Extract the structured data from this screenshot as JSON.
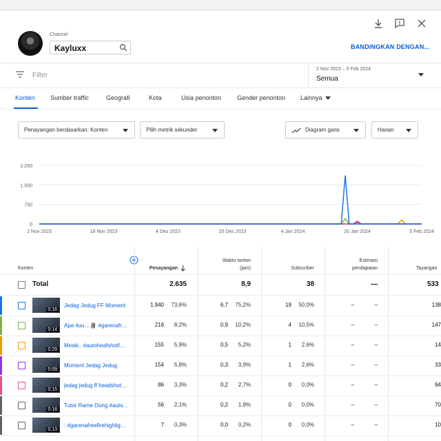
{
  "channel": {
    "label": "Channel",
    "name": "Kayluxx"
  },
  "compare_label": "BANDINGKAN DENGAN...",
  "filter": {
    "placeholder": "Filter"
  },
  "date": {
    "range": "2 Nov 2023 – 5 Feb 2024",
    "selected": "Semua"
  },
  "tabs": [
    "Konten",
    "Sumber traffic",
    "Geografi",
    "Kota",
    "Usia penonton",
    "Gender penonton",
    "Lainnya"
  ],
  "controls": {
    "views_by": "Penayangan berdasarkan: Konten",
    "secondary": "Pilih metrik sekunder",
    "chart_type": "Diagram garis",
    "interval": "Harian"
  },
  "colors": {
    "accent": "#065fd4",
    "series": [
      "#1a73e8",
      "#7cb342",
      "#f29900",
      "#9334e6",
      "#e8537a",
      "#5f6368",
      "#5f6368"
    ]
  },
  "chart_data": {
    "type": "line",
    "y_ticks": [
      "2.250",
      "1.500",
      "750",
      "0"
    ],
    "x_ticks": [
      "2 Nov 2023",
      "18 Nov 2023",
      "4 Des 2023",
      "20 Des 2023",
      "4 Jan 2024",
      "20 Jan 2024",
      "5 Feb 2024"
    ],
    "ylim": [
      0,
      2250
    ],
    "series": [
      {
        "color": "#1a73e8",
        "x": [
          "2023-11-02",
          "2024-01-16",
          "2024-01-17",
          "2024-01-18",
          "2024-02-05"
        ],
        "values": [
          0,
          0,
          1860,
          0,
          0
        ]
      },
      {
        "color": "#7cb342",
        "x": [
          "2023-11-02",
          "2024-01-16",
          "2024-01-17",
          "2024-01-18",
          "2024-02-05"
        ],
        "values": [
          0,
          0,
          200,
          0,
          0
        ]
      },
      {
        "color": "#f29900",
        "x": [
          "2023-11-02",
          "2024-01-30",
          "2024-01-31",
          "2024-02-01",
          "2024-02-05"
        ],
        "values": [
          0,
          0,
          150,
          0,
          0
        ]
      },
      {
        "color": "#9334e6",
        "x": [
          "2023-11-02",
          "2024-01-19",
          "2024-01-20",
          "2024-01-21",
          "2024-02-05"
        ],
        "values": [
          0,
          0,
          100,
          0,
          0
        ]
      },
      {
        "color": "#e8537a",
        "x": [
          "2023-11-02",
          "2024-01-19",
          "2024-01-20",
          "2024-01-21",
          "2024-02-05"
        ],
        "values": [
          0,
          0,
          60,
          0,
          0
        ]
      }
    ]
  },
  "table": {
    "headers": {
      "content": "Konten",
      "views": "Penayangan",
      "watch_time": [
        "Waktu tonton",
        "(jam)"
      ],
      "subscribers": "Subscriber",
      "revenue": [
        "Estimasi",
        "pendapatan"
      ],
      "impressions": "Tayangan"
    },
    "total": {
      "label": "Total",
      "views": "2.635",
      "watch": "8,9",
      "subs": "38",
      "revenue": "—",
      "impressions": "533"
    },
    "rows": [
      {
        "title": "Jedag Jedug FF Moment",
        "duration": "0:16",
        "views": "1.940",
        "views_pct": "73,6%",
        "watch": "6,7",
        "watch_pct": "75,2%",
        "subs": "19",
        "subs_pct": "50,0%",
        "rev": "–",
        "rev_pct": "–",
        "impressions": "138",
        "checked": false
      },
      {
        "title": "Apa ituu…🗿 #garenafr…",
        "duration": "0:14",
        "views": "216",
        "views_pct": "8,2%",
        "watch": "0,9",
        "watch_pct": "10,2%",
        "subs": "4",
        "subs_pct": "10,5%",
        "rev": "–",
        "rev_pct": "–",
        "impressions": "147",
        "checked": false
      },
      {
        "title": "Meski.. #autoheafshotf…",
        "duration": "0:29",
        "views": "155",
        "views_pct": "5,9%",
        "watch": "0,5",
        "watch_pct": "5,2%",
        "subs": "1",
        "subs_pct": "2,6%",
        "rev": "–",
        "rev_pct": "–",
        "impressions": "14",
        "checked": false
      },
      {
        "title": "Moment Jedag Jedug",
        "duration": "0:09",
        "views": "154",
        "views_pct": "5,8%",
        "watch": "0,3",
        "watch_pct": "3,9%",
        "subs": "1",
        "subs_pct": "2,6%",
        "rev": "–",
        "rev_pct": "–",
        "impressions": "33",
        "checked": false
      },
      {
        "title": "jedag jedug ff headshot…",
        "duration": "0:15",
        "views": "86",
        "views_pct": "3,3%",
        "watch": "0,2",
        "watch_pct": "2,7%",
        "subs": "0",
        "subs_pct": "0,0%",
        "rev": "–",
        "rev_pct": "–",
        "impressions": "94",
        "checked": false
      },
      {
        "title": "Tutor Rame Dong #auto…",
        "duration": "0:18",
        "views": "56",
        "views_pct": "2,1%",
        "watch": "0,2",
        "watch_pct": "1,9%",
        "subs": "0",
        "subs_pct": "0,0%",
        "rev": "–",
        "rev_pct": "–",
        "impressions": "70",
        "checked": false
      },
      {
        "title": ": #garenafreefirehighlig…",
        "duration": "0:13",
        "views": "7",
        "views_pct": "0,3%",
        "watch": "0,0",
        "watch_pct": "0,2%",
        "subs": "0",
        "subs_pct": "0,0%",
        "rev": "–",
        "rev_pct": "–",
        "impressions": "10",
        "checked": false
      }
    ]
  }
}
